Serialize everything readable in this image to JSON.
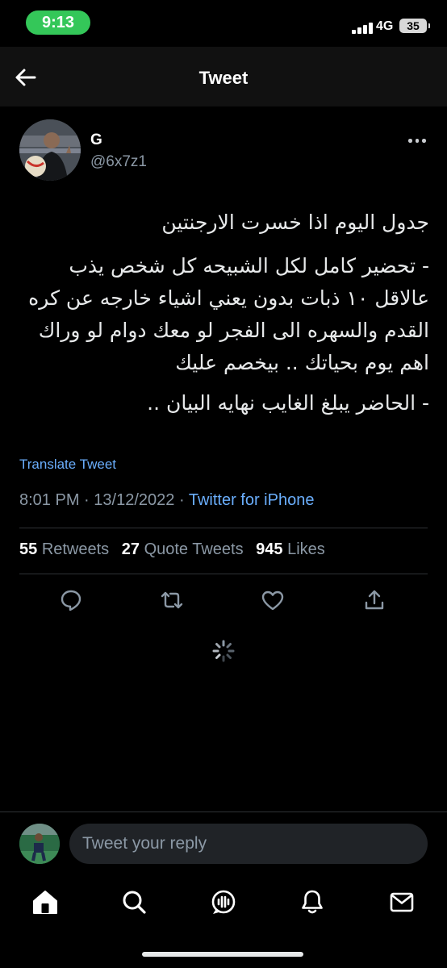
{
  "status_bar": {
    "time": "9:13",
    "network": "4G",
    "battery": "35"
  },
  "nav": {
    "title": "Tweet",
    "back_icon": "arrow-left-icon"
  },
  "tweet": {
    "author_name": "G",
    "author_handle": "@6x7z1",
    "paragraphs": [
      "جدول اليوم اذا خسرت الارجنتين",
      "- تحضير كامل لكل الشبيحه كل شخص يذب عالاقل ١٠ ذبات بدون يعني اشياء خارجه عن كره القدم والسهره الى الفجر لو معك دوام لو وراك اهم يوم بحياتك .. بيخصم عليك",
      "- الحاضر يبلغ الغايب نهايه البيان .."
    ],
    "translate_label": "Translate Tweet",
    "time": "8:01 PM",
    "separator": "·",
    "date": "13/12/2022",
    "source": "Twitter for iPhone",
    "stats": {
      "retweets_count": "55",
      "retweets_label": "Retweets",
      "quotes_count": "27",
      "quotes_label": "Quote Tweets",
      "likes_count": "945",
      "likes_label": "Likes"
    }
  },
  "actions": [
    "reply-icon",
    "retweet-icon",
    "like-icon",
    "share-icon"
  ],
  "reply": {
    "placeholder": "Tweet your reply"
  },
  "tabs": [
    "home-icon",
    "search-icon",
    "spaces-icon",
    "notifications-icon",
    "messages-icon"
  ],
  "colors": {
    "background": "#000000",
    "link": "#6aaefc",
    "secondary_text": "#8b98a5",
    "status_pill": "#34c759"
  }
}
